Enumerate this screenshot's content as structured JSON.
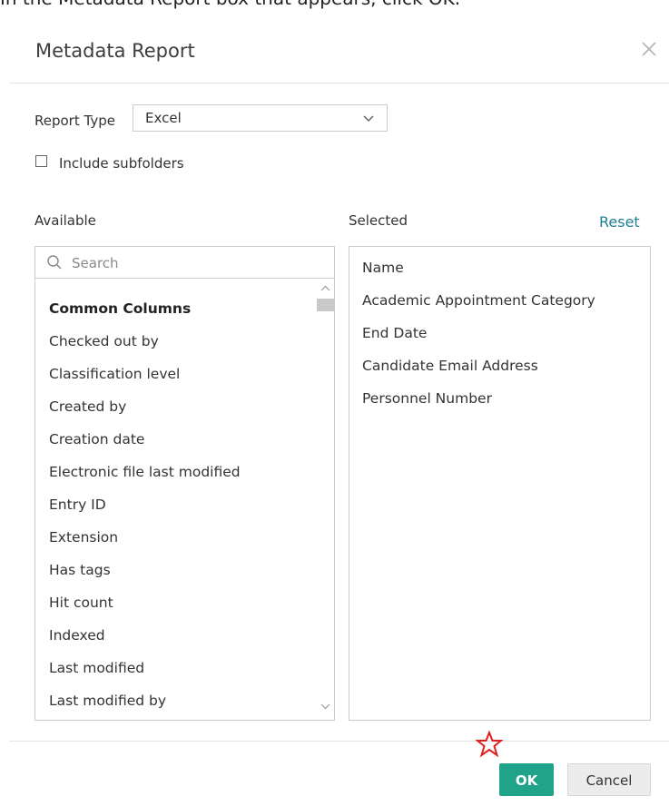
{
  "instruction": "In the Metadata Report box that appears, click OK.",
  "dialog": {
    "title": "Metadata Report",
    "close_icon": "close-icon"
  },
  "report_type": {
    "label": "Report Type",
    "value": "Excel"
  },
  "include_subfolders": {
    "label": "Include subfolders",
    "checked": false
  },
  "available": {
    "label": "Available",
    "search_placeholder": "Search",
    "items": [
      {
        "label": "Common Columns",
        "header": true
      },
      {
        "label": "Checked out by"
      },
      {
        "label": "Classification level"
      },
      {
        "label": "Created by"
      },
      {
        "label": "Creation date"
      },
      {
        "label": "Electronic file last modified"
      },
      {
        "label": "Entry ID"
      },
      {
        "label": "Extension"
      },
      {
        "label": "Has tags"
      },
      {
        "label": "Hit count"
      },
      {
        "label": "Indexed"
      },
      {
        "label": "Last modified"
      },
      {
        "label": "Last modified by"
      }
    ]
  },
  "selected": {
    "label": "Selected",
    "reset_label": "Reset",
    "items": [
      "Name",
      "Academic Appointment Category",
      "End Date",
      "Candidate Email Address",
      "Personnel Number"
    ]
  },
  "footer": {
    "ok_label": "OK",
    "cancel_label": "Cancel",
    "ok_color": "#21a38a"
  },
  "annotation": {
    "icon": "star-icon",
    "color": "#e02020"
  },
  "colors": {
    "link": "#1f7f95",
    "border": "#cccccc"
  }
}
